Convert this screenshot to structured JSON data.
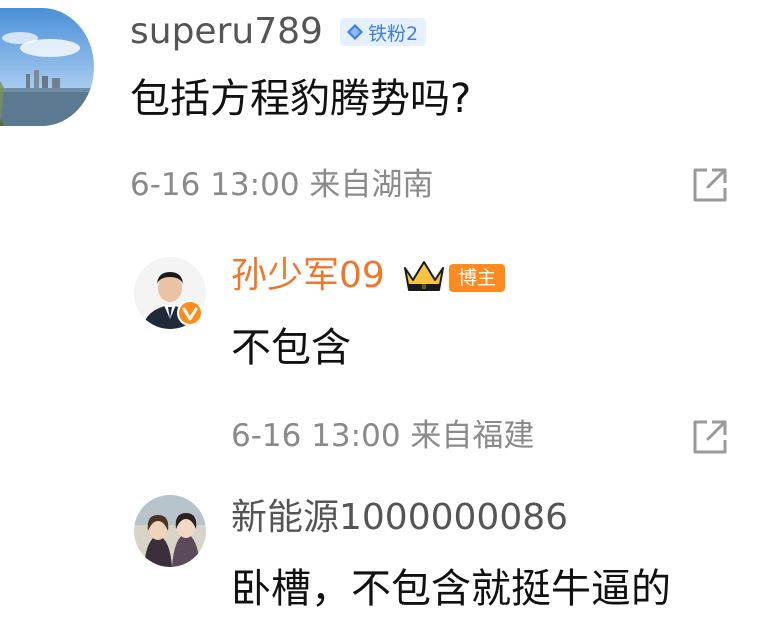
{
  "comments": [
    {
      "username": "superu789",
      "badge": "铁粉2",
      "text": "包括方程豹腾势吗?",
      "meta": "6-16 13:00 来自湖南"
    },
    {
      "username": "孙少军09",
      "badge": "博主",
      "text": "不包含",
      "meta": "6-16 13:00 来自福建"
    },
    {
      "username": "新能源1000000086",
      "text": "卧槽，不包含就挺牛逼的"
    }
  ],
  "colors": {
    "username_default": "#555555",
    "username_host": "#f0762a",
    "meta": "#8a8a8a",
    "fan_badge": "#3d7fe6",
    "host_badge": "#ff8a1f"
  },
  "icons": {
    "share": "share-icon",
    "verified": "verified-v-icon",
    "crown": "crown-icon",
    "diamond": "diamond-icon"
  }
}
